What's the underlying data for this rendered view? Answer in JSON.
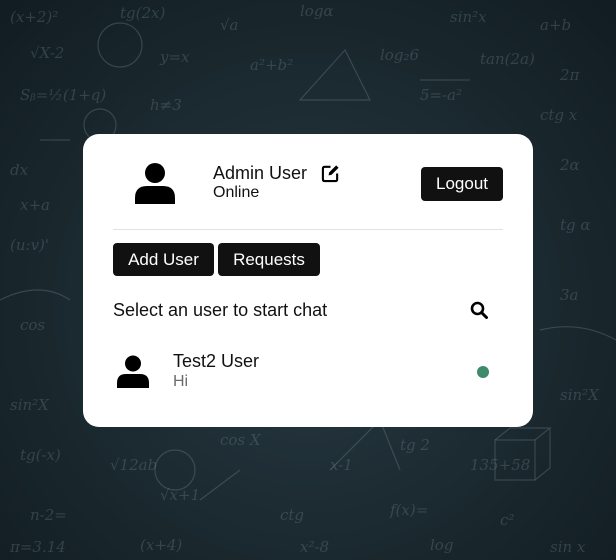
{
  "profile": {
    "name": "Admin User",
    "status": "Online",
    "avatar_icon": "user-silhouette-icon",
    "edit_icon": "edit-icon"
  },
  "header": {
    "logout_label": "Logout"
  },
  "actions": {
    "add_user_label": "Add User",
    "requests_label": "Requests"
  },
  "chat": {
    "prompt": "Select an user to start chat",
    "search_icon": "search-icon"
  },
  "users": [
    {
      "name": "Test2 User",
      "last_message": "Hi",
      "online": true
    }
  ],
  "colors": {
    "button_bg": "#111111",
    "online_dot": "#3f8a6a",
    "card_bg": "#ffffff"
  }
}
